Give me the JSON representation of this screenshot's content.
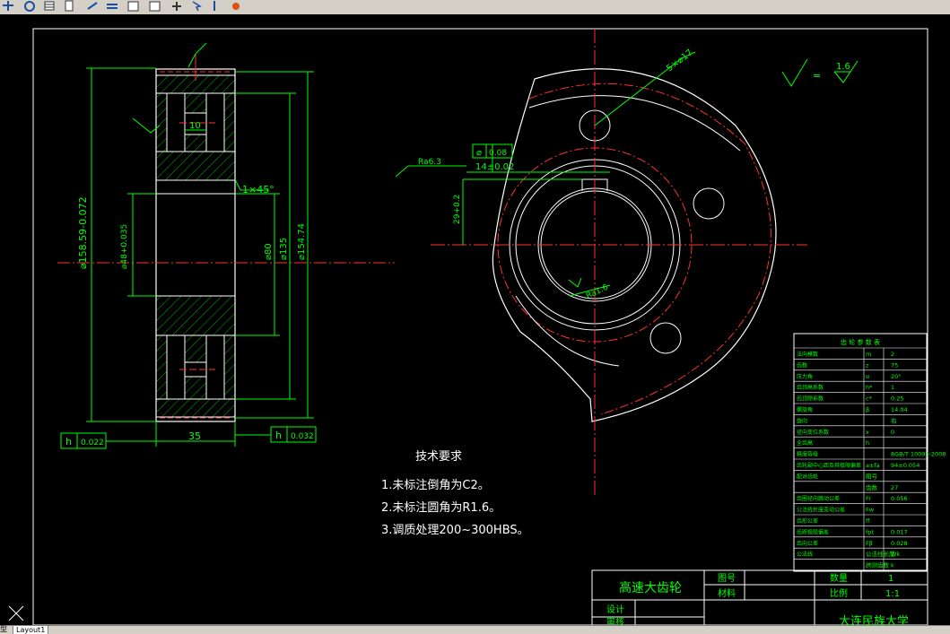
{
  "toolbar": {
    "icons": [
      "pan-icon",
      "orbit-icon",
      "grid-icon",
      "properties-icon",
      "match-icon",
      "box-icon",
      "window-icon",
      "move-icon",
      "pick-icon",
      "paint-icon"
    ]
  },
  "drawing": {
    "left_view": {
      "dim_outer": "⌀158.59-0.072",
      "dim_bore": "⌀48+0.035",
      "dim_80": "⌀80",
      "dim_135": "⌀135",
      "dim_15474": "⌀154.74",
      "dim_10": "10",
      "dim_35": "35",
      "chamfer": "1×45°",
      "tol_left_sym": "h",
      "tol_left_val": "0.022",
      "tol_right_sym": "h",
      "tol_right_val": "0.032"
    },
    "right_view": {
      "holes": "5×⌀17",
      "tol_sym": "⌀",
      "tol_val": "0.08",
      "keyway_width": "14±0.02",
      "keyway_depth": "29+0.2",
      "roughness_top": "Ra6.3",
      "roughness_bore": "Ra1.6"
    },
    "roughness_corner": {
      "eq": "=",
      "value": "1.6"
    }
  },
  "tech_requirements": {
    "title": "技术要求",
    "items": [
      "1.未标注倒角为C2。",
      "2.未标注圆角为R1.6。",
      "3.调质处理200~300HBS。"
    ]
  },
  "param_table": {
    "header": "齿 轮 参 数 表",
    "rows": [
      [
        "法向模数",
        "m",
        "2"
      ],
      [
        "齿数",
        "z",
        "75"
      ],
      [
        "压力角",
        "α",
        "20°"
      ],
      [
        "齿顶高系数",
        "h*",
        "1"
      ],
      [
        "齿顶隙系数",
        "c*",
        "0.25"
      ],
      [
        "螺旋角",
        "β",
        "14.04"
      ],
      [
        "旋向",
        "",
        "右"
      ],
      [
        "径向变位系数",
        "x",
        "0"
      ],
      [
        "全齿高",
        "h",
        ""
      ],
      [
        "精度等级",
        "",
        "8GB/T 10095-2008"
      ],
      [
        "齿轮副中心距及其极限偏差",
        "a±fa",
        "94±0.054"
      ],
      [
        "配对齿轮",
        "图号",
        ""
      ],
      [
        "",
        "齿数",
        "27"
      ],
      [
        "齿圈径向跳动公差",
        "Fr",
        "0.056"
      ],
      [
        "公法线长度变动公差",
        "Fw",
        ""
      ],
      [
        "齿形公差",
        "ff",
        ""
      ],
      [
        "齿距极限偏差",
        "fpt",
        "0.017"
      ],
      [
        "齿向公差",
        "Fβ",
        "0.028"
      ],
      [
        "公法线",
        "公法线长度",
        "Wk"
      ],
      [
        "",
        "跨测齿数",
        "k"
      ]
    ]
  },
  "title_block": {
    "part_name": "高速大齿轮",
    "drawing_no_label": "图号",
    "material_label": "材料",
    "qty_label": "数量",
    "qty_value": "1",
    "scale_label": "比例",
    "scale_value": "1:1",
    "designer_label": "设计",
    "checker_label": "审核",
    "school": "大连民族大学"
  },
  "status": {
    "layout_tab": "Layout1",
    "model_mark": "型"
  },
  "colors": {
    "background": "#000000",
    "dims": "#00ff00",
    "center": "#ff0000",
    "outline": "#ffffff",
    "text": "#ffffff"
  }
}
